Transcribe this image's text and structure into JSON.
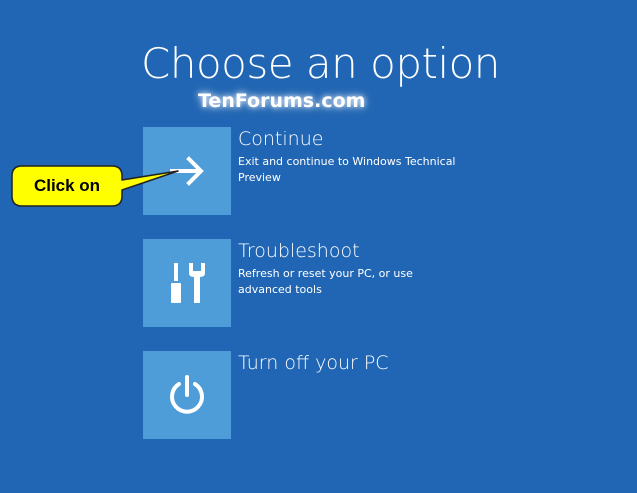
{
  "page": {
    "title": "Choose an option",
    "watermark": "TenForums.com",
    "background_color": "#2166b4",
    "tile_color": "#4e9cd8"
  },
  "options": [
    {
      "title": "Continue",
      "description": "Exit and continue to Windows Technical Preview",
      "icon": "arrow-right-icon"
    },
    {
      "title": "Troubleshoot",
      "description": "Refresh or reset your PC, or use advanced tools",
      "icon": "screwdriver-wrench-icon"
    },
    {
      "title": "Turn off your PC",
      "description": "",
      "icon": "power-icon"
    }
  ],
  "callout": {
    "label": "Click on",
    "fill_color": "#ffff00"
  }
}
